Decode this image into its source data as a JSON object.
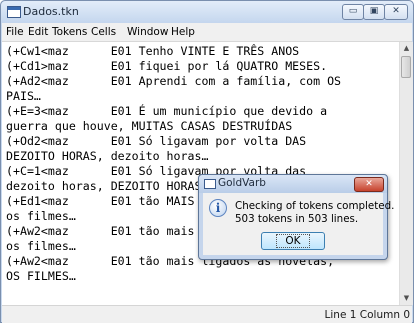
{
  "window": {
    "title": "Dados.tkn",
    "minimize_glyph": "▭",
    "maximize_glyph": "▣",
    "close_glyph": "✕"
  },
  "menu": {
    "items": [
      "File",
      "Edit",
      "Tokens",
      "Cells",
      "Window",
      "Help"
    ]
  },
  "editor": {
    "lines": [
      "(+Cw1<maz      E01 Tenho VINTE E TRÊS ANOS",
      "(+Cd1>maz      E01 fiquei por lá QUATRO MESES.",
      "(+Ad2<maz      E01 Aprendi com a família, com OS",
      "PAIS…",
      "(+E=3<maz      E01 É um município que devido a",
      "guerra que houve, MUITAS CASAS DESTRUÍDAS",
      "(+Od2<maz      E01 Só ligavam por volta DAS",
      "DEZOITO HORAS, dezoito horas…",
      "(+C=1<maz      E01 Só ligavam por volta das",
      "dezoito horas, DEZOITO HORAS…",
      "(+Ed1<maz      E01 tão MAIS LIGADOS às novelas,",
      "os filmes…",
      "(+Aw2<maz      E01 tão mais ligados às novelas,",
      "os filmes…",
      "(+Aw2<maz      E01 tão mais ligados às novelas,",
      "OS FILMES…"
    ]
  },
  "scrollbar": {
    "up_glyph": "▲",
    "down_glyph": "▼"
  },
  "status": {
    "text": "Line 1 Column 0"
  },
  "dialog": {
    "title": "GoldVarb",
    "close_glyph": "✕",
    "icon_glyph": "i",
    "message_line1": "Checking of tokens completed.",
    "message_line2": "503 tokens in 503 lines.",
    "ok_label": "OK"
  }
}
